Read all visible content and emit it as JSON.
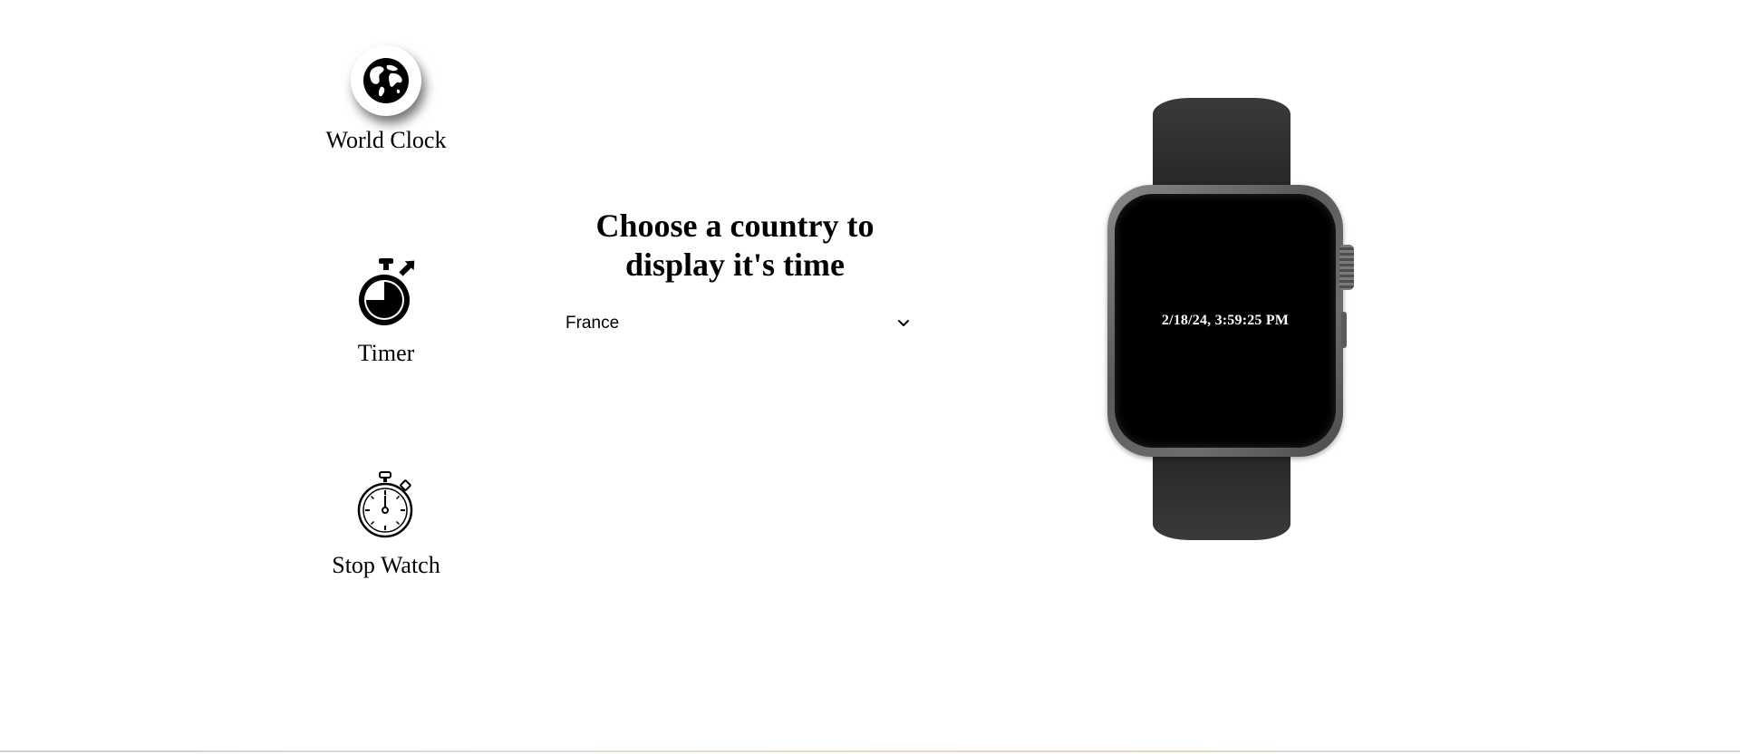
{
  "nav": {
    "items": [
      {
        "label": "World Clock",
        "icon": "globe-icon"
      },
      {
        "label": "Timer",
        "icon": "timer-icon"
      },
      {
        "label": "Stop Watch",
        "icon": "stopwatch-icon"
      }
    ]
  },
  "selector": {
    "heading": "Choose a country to display it's time",
    "selected_country": "France",
    "dropdown_icon": "chevron-down-icon"
  },
  "watch": {
    "display_time": "2/18/24, 3:59:25 PM"
  },
  "colors": {
    "background": "#ffffff",
    "text": "#000000",
    "watch_band": "#2b2b2b",
    "watch_case": "#6d6d6d",
    "watch_screen": "#000000",
    "watch_text": "#ffffff"
  }
}
